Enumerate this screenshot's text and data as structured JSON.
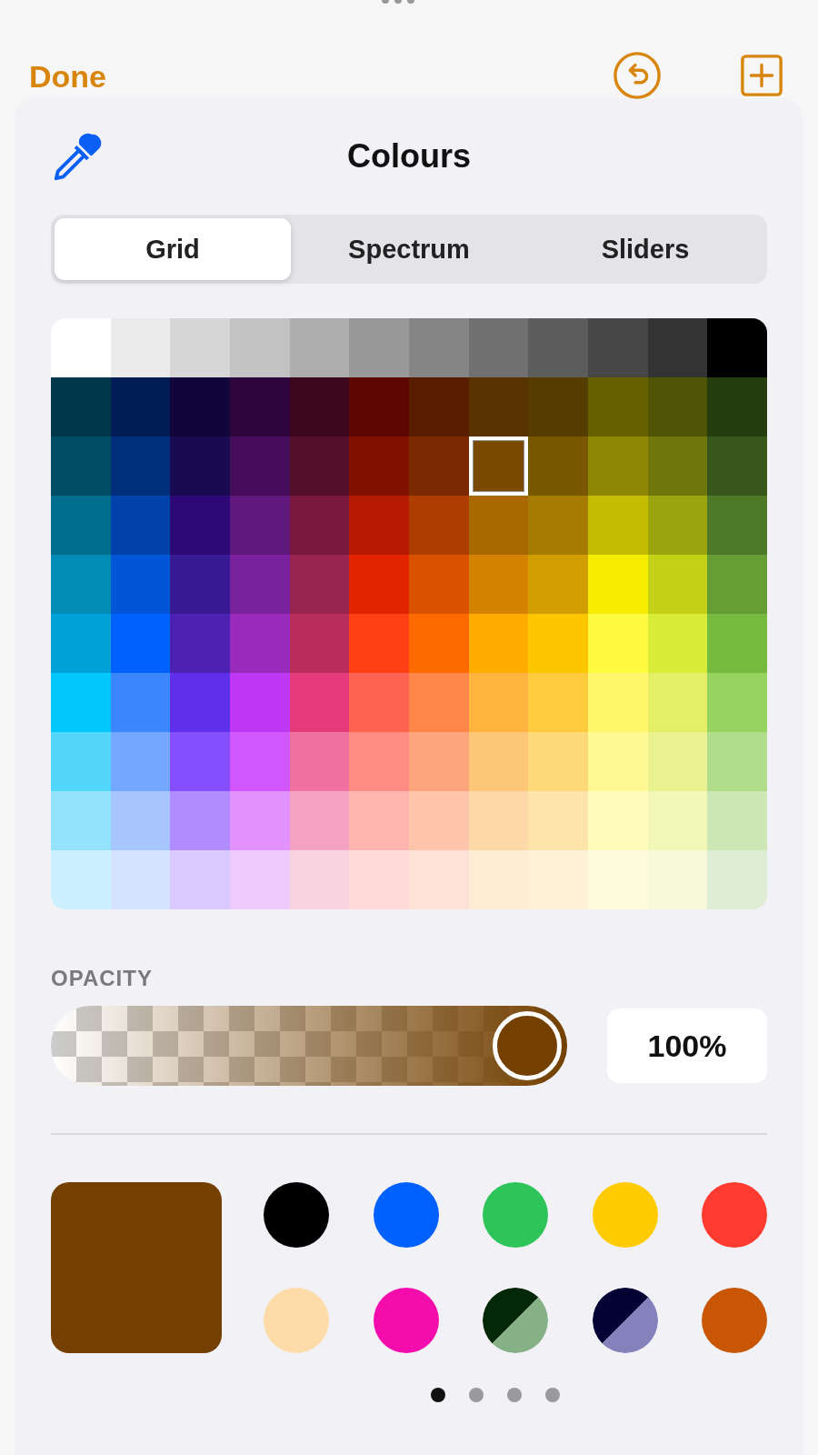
{
  "nav": {
    "done": "Done"
  },
  "sheet": {
    "title": "Colours"
  },
  "tabs": [
    {
      "label": "Grid",
      "selected": true
    },
    {
      "label": "Spectrum",
      "selected": false
    },
    {
      "label": "Sliders",
      "selected": false
    }
  ],
  "grid": [
    [
      {
        "color": "#ffffff",
        "selected": false
      },
      {
        "color": "#ebebeb",
        "selected": false
      },
      {
        "color": "#d6d6d6",
        "selected": false
      },
      {
        "color": "#c2c2c2",
        "selected": false
      },
      {
        "color": "#adadad",
        "selected": false
      },
      {
        "color": "#999999",
        "selected": false
      },
      {
        "color": "#858585",
        "selected": false
      },
      {
        "color": "#707070",
        "selected": false
      },
      {
        "color": "#5c5c5c",
        "selected": false
      },
      {
        "color": "#474747",
        "selected": false
      },
      {
        "color": "#333333",
        "selected": false
      },
      {
        "color": "#000000",
        "selected": false
      }
    ],
    [
      {
        "color": "#00374a",
        "selected": false
      },
      {
        "color": "#011d57",
        "selected": false
      },
      {
        "color": "#11053b",
        "selected": false
      },
      {
        "color": "#2e063d",
        "selected": false
      },
      {
        "color": "#3c071b",
        "selected": false
      },
      {
        "color": "#5c0701",
        "selected": false
      },
      {
        "color": "#5a1c00",
        "selected": false
      },
      {
        "color": "#583300",
        "selected": false
      },
      {
        "color": "#563d00",
        "selected": false
      },
      {
        "color": "#666100",
        "selected": false
      },
      {
        "color": "#4f5504",
        "selected": false
      },
      {
        "color": "#263e0f",
        "selected": false
      }
    ],
    [
      {
        "color": "#004d65",
        "selected": false
      },
      {
        "color": "#012f7b",
        "selected": false
      },
      {
        "color": "#1a0a52",
        "selected": false
      },
      {
        "color": "#450d59",
        "selected": false
      },
      {
        "color": "#551029",
        "selected": false
      },
      {
        "color": "#831100",
        "selected": false
      },
      {
        "color": "#7b2900",
        "selected": false
      },
      {
        "color": "#7a4a00",
        "selected": true
      },
      {
        "color": "#785800",
        "selected": false
      },
      {
        "color": "#8d8602",
        "selected": false
      },
      {
        "color": "#6f760a",
        "selected": false
      },
      {
        "color": "#38571a",
        "selected": false
      }
    ],
    [
      {
        "color": "#016e8f",
        "selected": false
      },
      {
        "color": "#0042a9",
        "selected": false
      },
      {
        "color": "#2c0977",
        "selected": false
      },
      {
        "color": "#61187c",
        "selected": false
      },
      {
        "color": "#791a3d",
        "selected": false
      },
      {
        "color": "#b51a00",
        "selected": false
      },
      {
        "color": "#ad3e00",
        "selected": false
      },
      {
        "color": "#a96800",
        "selected": false
      },
      {
        "color": "#a67b01",
        "selected": false
      },
      {
        "color": "#c4bc00",
        "selected": false
      },
      {
        "color": "#9ba50e",
        "selected": false
      },
      {
        "color": "#4e7a27",
        "selected": false
      }
    ],
    [
      {
        "color": "#008cb4",
        "selected": false
      },
      {
        "color": "#0056d6",
        "selected": false
      },
      {
        "color": "#371a94",
        "selected": false
      },
      {
        "color": "#7a219e",
        "selected": false
      },
      {
        "color": "#99244f",
        "selected": false
      },
      {
        "color": "#e22400",
        "selected": false
      },
      {
        "color": "#da5100",
        "selected": false
      },
      {
        "color": "#d38301",
        "selected": false
      },
      {
        "color": "#d19d01",
        "selected": false
      },
      {
        "color": "#f5ec00",
        "selected": false
      },
      {
        "color": "#c3d117",
        "selected": false
      },
      {
        "color": "#669d34",
        "selected": false
      }
    ],
    [
      {
        "color": "#00a1d8",
        "selected": false
      },
      {
        "color": "#0061fd",
        "selected": false
      },
      {
        "color": "#4d22b2",
        "selected": false
      },
      {
        "color": "#982abc",
        "selected": false
      },
      {
        "color": "#b92d5d",
        "selected": false
      },
      {
        "color": "#ff4015",
        "selected": false
      },
      {
        "color": "#ff6a00",
        "selected": false
      },
      {
        "color": "#ffab01",
        "selected": false
      },
      {
        "color": "#fcc700",
        "selected": false
      },
      {
        "color": "#fefb41",
        "selected": false
      },
      {
        "color": "#d9ec37",
        "selected": false
      },
      {
        "color": "#76bb40",
        "selected": false
      }
    ],
    [
      {
        "color": "#01c7fc",
        "selected": false
      },
      {
        "color": "#3a87fd",
        "selected": false
      },
      {
        "color": "#5e30eb",
        "selected": false
      },
      {
        "color": "#be38f3",
        "selected": false
      },
      {
        "color": "#e63b7a",
        "selected": false
      },
      {
        "color": "#fe6250",
        "selected": false
      },
      {
        "color": "#fe8648",
        "selected": false
      },
      {
        "color": "#feb43f",
        "selected": false
      },
      {
        "color": "#fecb3e",
        "selected": false
      },
      {
        "color": "#fff76b",
        "selected": false
      },
      {
        "color": "#e4ef65",
        "selected": false
      },
      {
        "color": "#96d35f",
        "selected": false
      }
    ],
    [
      {
        "color": "#52d6fc",
        "selected": false
      },
      {
        "color": "#74a7ff",
        "selected": false
      },
      {
        "color": "#864ffd",
        "selected": false
      },
      {
        "color": "#d357fe",
        "selected": false
      },
      {
        "color": "#ee719e",
        "selected": false
      },
      {
        "color": "#ff8c82",
        "selected": false
      },
      {
        "color": "#fea57d",
        "selected": false
      },
      {
        "color": "#fec777",
        "selected": false
      },
      {
        "color": "#fed977",
        "selected": false
      },
      {
        "color": "#fff994",
        "selected": false
      },
      {
        "color": "#eaf28f",
        "selected": false
      },
      {
        "color": "#b1dd8b",
        "selected": false
      }
    ],
    [
      {
        "color": "#93e3fc",
        "selected": false
      },
      {
        "color": "#a7c6ff",
        "selected": false
      },
      {
        "color": "#b18cfe",
        "selected": false
      },
      {
        "color": "#e292fe",
        "selected": false
      },
      {
        "color": "#f4a4c0",
        "selected": false
      },
      {
        "color": "#ffb5af",
        "selected": false
      },
      {
        "color": "#ffc5ab",
        "selected": false
      },
      {
        "color": "#fed9a8",
        "selected": false
      },
      {
        "color": "#fde4a8",
        "selected": false
      },
      {
        "color": "#fffbb9",
        "selected": false
      },
      {
        "color": "#f1f7b7",
        "selected": false
      },
      {
        "color": "#cde8b5",
        "selected": false
      }
    ],
    [
      {
        "color": "#cbf0ff",
        "selected": false
      },
      {
        "color": "#d3e2ff",
        "selected": false
      },
      {
        "color": "#d9c9fe",
        "selected": false
      },
      {
        "color": "#efcaff",
        "selected": false
      },
      {
        "color": "#f9d3e0",
        "selected": false
      },
      {
        "color": "#ffdad8",
        "selected": false
      },
      {
        "color": "#ffe2d6",
        "selected": false
      },
      {
        "color": "#feecd4",
        "selected": false
      },
      {
        "color": "#fef1d5",
        "selected": false
      },
      {
        "color": "#fdfbdd",
        "selected": false
      },
      {
        "color": "#f6fadb",
        "selected": false
      },
      {
        "color": "#deeed4",
        "selected": false
      }
    ]
  ],
  "opacity": {
    "label": "OPACITY",
    "level": 1.0,
    "reading": "100%"
  },
  "current": {
    "color": "#734000"
  },
  "favorites": [
    {
      "kind": "solid",
      "color": "#000000"
    },
    {
      "kind": "solid",
      "color": "#0061fe"
    },
    {
      "kind": "solid",
      "color": "#2dc55a"
    },
    {
      "kind": "solid",
      "color": "#fecb00"
    },
    {
      "kind": "solid",
      "color": "#ff3b30"
    },
    {
      "kind": "solid",
      "color": "#fedcaa"
    },
    {
      "kind": "solid",
      "color": "#f50cad"
    },
    {
      "kind": "split",
      "halves": [
        {
          "color": "#032809"
        },
        {
          "color": "#86b187"
        }
      ]
    },
    {
      "kind": "split",
      "halves": [
        {
          "color": "#030033"
        },
        {
          "color": "#8481bd"
        }
      ]
    },
    {
      "kind": "solid",
      "color": "#c85604"
    }
  ],
  "pages": [
    {
      "selected": true
    },
    {
      "selected": false
    },
    {
      "selected": false
    },
    {
      "selected": false
    }
  ]
}
